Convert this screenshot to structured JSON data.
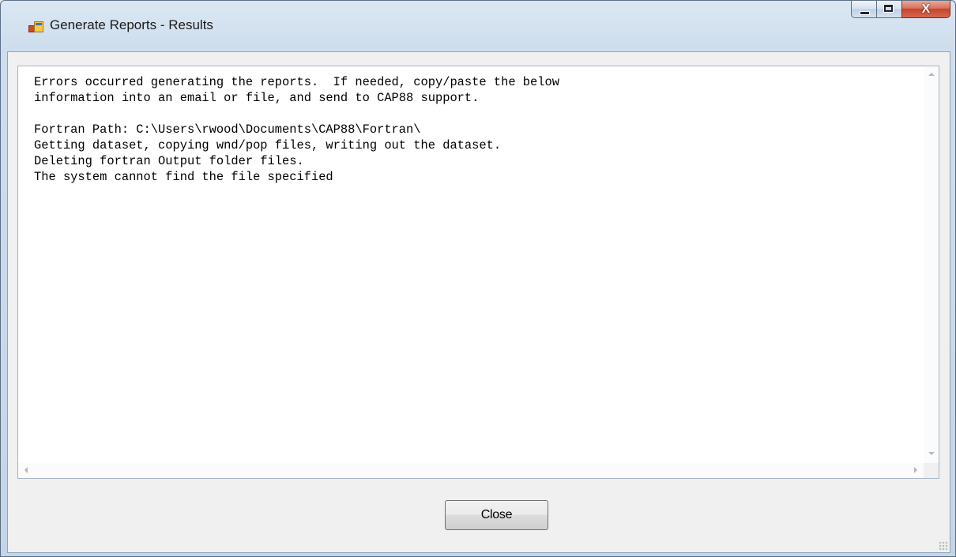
{
  "window": {
    "title": "Generate Reports - Results",
    "icon": "application-icon",
    "caption_buttons": {
      "minimize": "minimize-icon",
      "maximize": "maximize-icon",
      "close": "X"
    }
  },
  "output": {
    "lines": [
      "Errors occurred generating the reports.  If needed, copy/paste the below",
      "information into an email or file, and send to CAP88 support.",
      "",
      "Fortran Path: C:\\Users\\rwood\\Documents\\CAP88\\Fortran\\",
      "Getting dataset, copying wnd/pop files, writing out the dataset.",
      "Deleting fortran Output folder files.",
      "The system cannot find the file specified"
    ]
  },
  "buttons": {
    "close_label": "Close"
  },
  "colors": {
    "title_bar": "#cfdeee",
    "close_caption": "#c5442a",
    "client_bg": "#f0f0f0"
  }
}
